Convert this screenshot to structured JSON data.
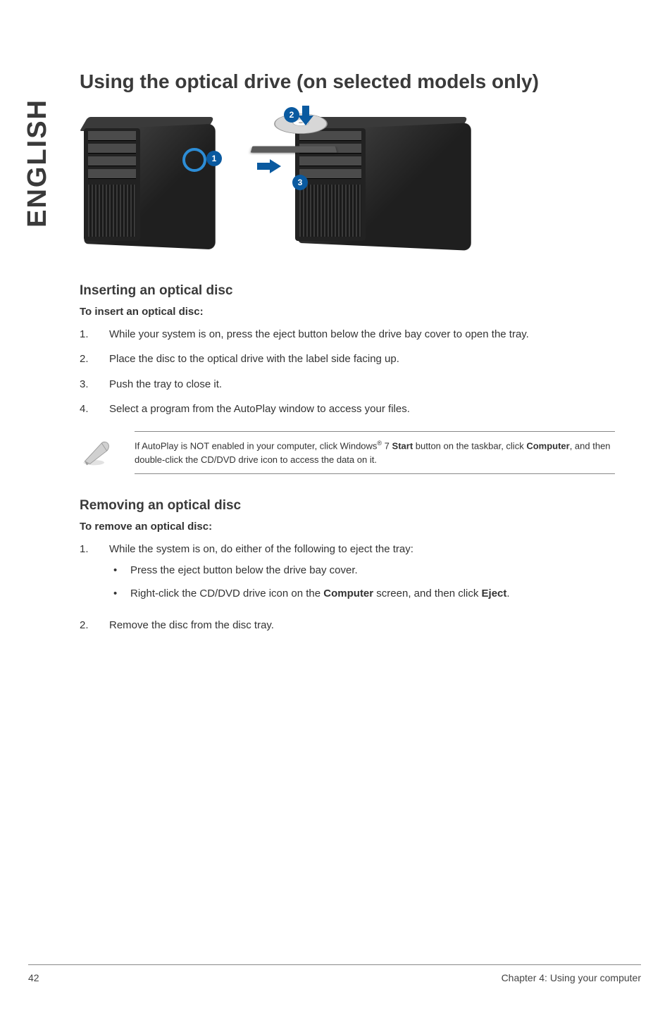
{
  "sidetab": "ENGLISH",
  "title": "Using the optical drive (on selected models only)",
  "callouts": {
    "c1": "1",
    "c2": "2",
    "c3": "3"
  },
  "insert": {
    "heading": "Inserting an optical disc",
    "proc_label": "To insert an optical disc:",
    "steps": [
      "While your system is on, press the eject button below the drive bay cover to open the tray.",
      "Place the disc to the optical drive with the label side facing up.",
      "Push the tray to close it.",
      "Select a program from the AutoPlay window to access your files."
    ]
  },
  "note": {
    "pre": "If AutoPlay is NOT enabled in your computer, click Windows",
    "sup": "®",
    "mid": " 7 ",
    "bold1": "Start",
    "post1": " button on the taskbar, click ",
    "bold2": "Computer",
    "post2": ", and then double-click the CD/DVD drive icon to access the data on it."
  },
  "remove": {
    "heading": "Removing an optical disc",
    "proc_label": "To remove an optical disc:",
    "step1": "While the system is on, do either of the following to eject the tray:",
    "bullets": [
      {
        "text": "Press the eject button below the drive bay cover."
      },
      {
        "pre": "Right-click the CD/DVD drive icon on the ",
        "b1": "Computer",
        "mid": " screen, and then click ",
        "b2": "Eject",
        "post": "."
      }
    ],
    "step2": "Remove the disc from the disc tray."
  },
  "footer": {
    "page": "42",
    "chapter": "Chapter 4: Using your computer"
  }
}
